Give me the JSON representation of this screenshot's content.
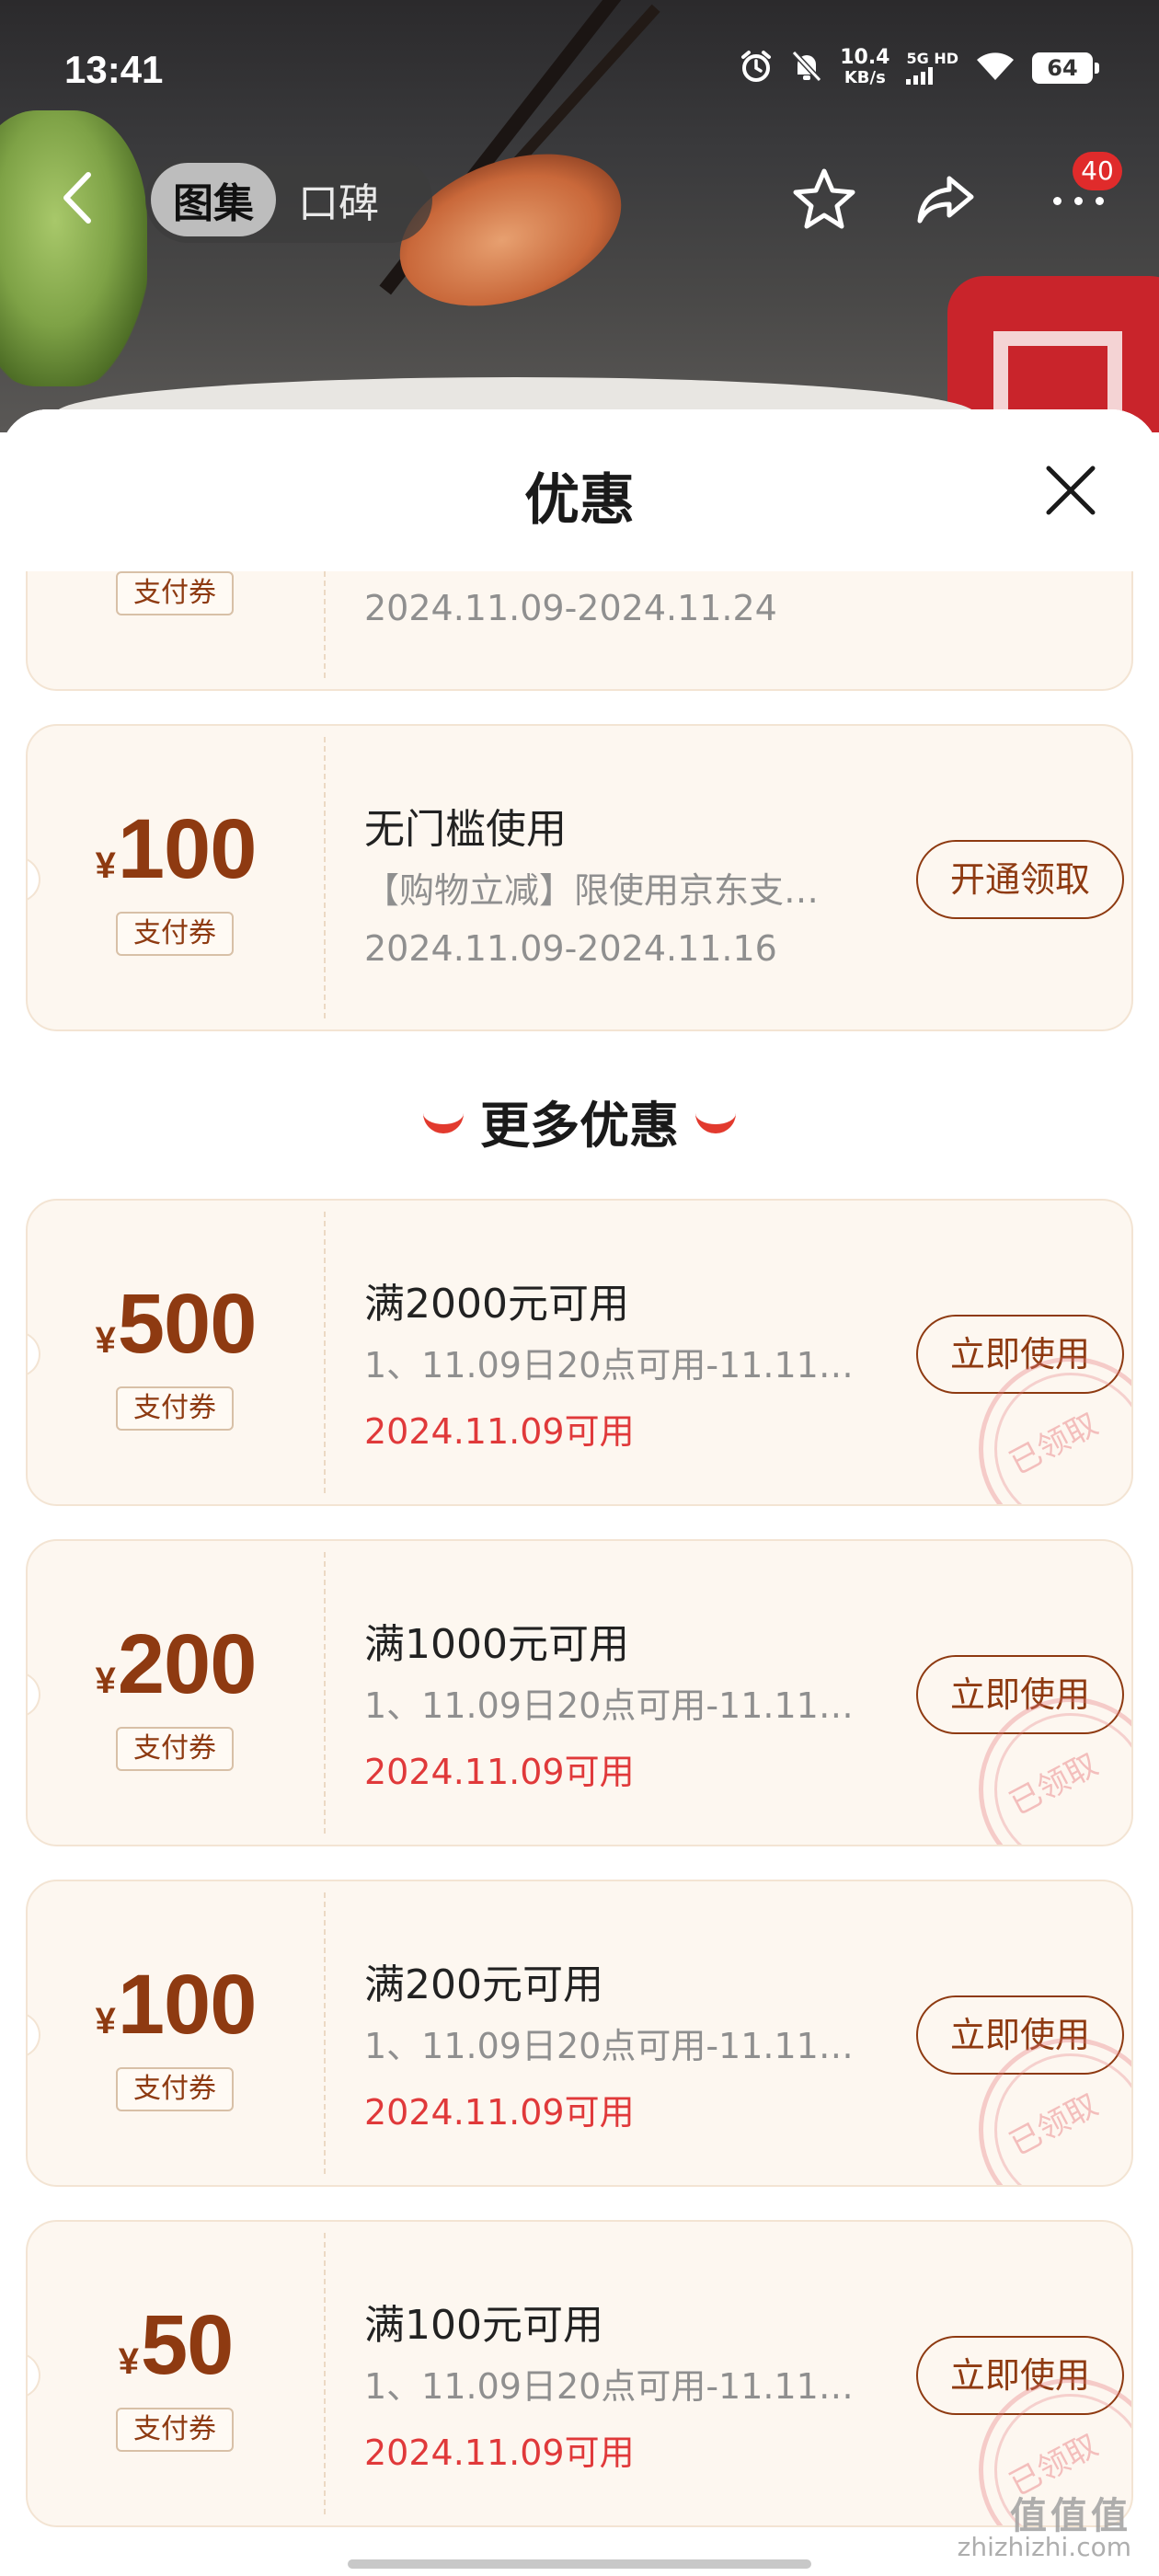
{
  "status_bar": {
    "time": "13:41",
    "net_speed_value": "10.4",
    "net_speed_unit": "KB/s",
    "network_type": "5G HD",
    "battery": "64"
  },
  "nav": {
    "tabs": [
      {
        "label": "图集",
        "active": true
      },
      {
        "label": "口碑",
        "active": false
      }
    ],
    "badge_count": "40"
  },
  "sheet": {
    "title": "优惠",
    "top_coupons": [
      {
        "currency": "",
        "amount": "",
        "tag": "支付券",
        "title": "",
        "desc": "",
        "date": "2024.11.09-2024.11.24",
        "button": ""
      },
      {
        "currency": "¥",
        "amount": "100",
        "tag": "支付券",
        "title": "无门槛使用",
        "desc": "【购物立减】限使用京东支…",
        "date": "2024.11.09-2024.11.16",
        "button": "开通领取"
      }
    ],
    "more_section_title": "更多优惠",
    "more_coupons": [
      {
        "currency": "¥",
        "amount": "500",
        "tag": "支付券",
        "title": "满2000元可用",
        "desc": "1、11.09日20点可用-11.11…",
        "date": "2024.11.09可用",
        "button": "立即使用",
        "stamp": "已领取"
      },
      {
        "currency": "¥",
        "amount": "200",
        "tag": "支付券",
        "title": "满1000元可用",
        "desc": "1、11.09日20点可用-11.11…",
        "date": "2024.11.09可用",
        "button": "立即使用",
        "stamp": "已领取"
      },
      {
        "currency": "¥",
        "amount": "100",
        "tag": "支付券",
        "title": "满200元可用",
        "desc": "1、11.09日20点可用-11.11…",
        "date": "2024.11.09可用",
        "button": "立即使用",
        "stamp": "已领取"
      },
      {
        "currency": "¥",
        "amount": "50",
        "tag": "支付券",
        "title": "满100元可用",
        "desc": "1、11.09日20点可用-11.11…",
        "date": "2024.11.09可用",
        "button": "立即使用",
        "stamp": "已领取"
      }
    ]
  },
  "watermark": {
    "text": "值值值",
    "url": "zhizhizhi.com"
  },
  "colors": {
    "accent_brown": "#8e3a11",
    "date_red": "#e0393a",
    "coupon_bg": "#fdf7f0",
    "section_smile": "#e23a2e",
    "badge_red": "#e02b2b"
  }
}
